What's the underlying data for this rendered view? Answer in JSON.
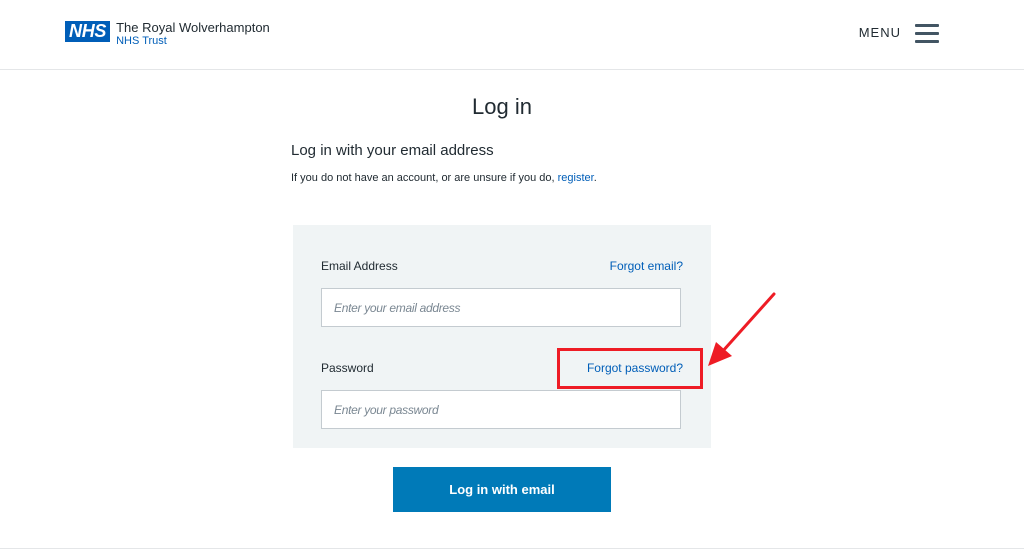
{
  "header": {
    "logo_badge": "NHS",
    "org_name_line1": "The Royal Wolverhampton",
    "org_name_line2": "NHS Trust",
    "menu_label": "MENU"
  },
  "main": {
    "title": "Log in",
    "subheading": "Log in with your email address",
    "intro_text": "If you do not have an account, or are unsure if you do,",
    "register_link": "register",
    "intro_end": "."
  },
  "form": {
    "email_label": "Email Address",
    "forgot_email_link": "Forgot email?",
    "email_value": "",
    "email_placeholder": "Enter your email address",
    "password_label": "Password",
    "forgot_password_link": "Forgot password?",
    "password_value": "",
    "password_placeholder": "Enter your password",
    "submit_label": "Log in with email"
  },
  "colors": {
    "nhs_blue": "#005eb8",
    "button_blue": "#007ab8",
    "panel_background": "#f0f4f5",
    "annotation_red": "#ee1c25"
  },
  "icons": {
    "menu": "hamburger-menu-icon",
    "annotation": "red-arrow-icon"
  }
}
